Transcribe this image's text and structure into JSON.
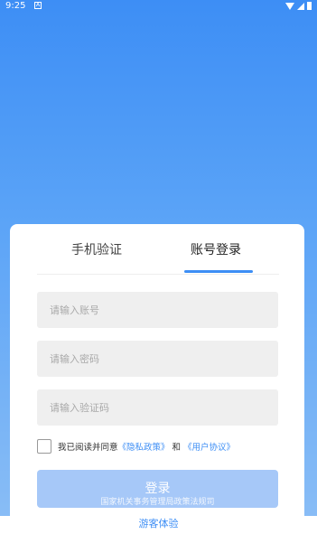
{
  "status_bar": {
    "time": "9:25",
    "notification_icon": "A"
  },
  "tabs": {
    "phone_verify": "手机验证",
    "account_login": "账号登录",
    "active": "account_login"
  },
  "form": {
    "account_placeholder": "请输入账号",
    "password_placeholder": "请输入密码",
    "captcha_placeholder": "请输入验证码"
  },
  "agreement": {
    "prefix": "我已阅读并同意",
    "privacy_link": "《隐私政策》",
    "and": "和",
    "user_link": "《用户协议》"
  },
  "login_button": {
    "label": "登录",
    "footer_text": "国家机关事务管理局政策法规司"
  },
  "guest": {
    "label": "游客体验"
  },
  "colors": {
    "primary": "#3d8ef5",
    "button_disabled": "#a6c8f8",
    "input_bg": "#efefef"
  }
}
